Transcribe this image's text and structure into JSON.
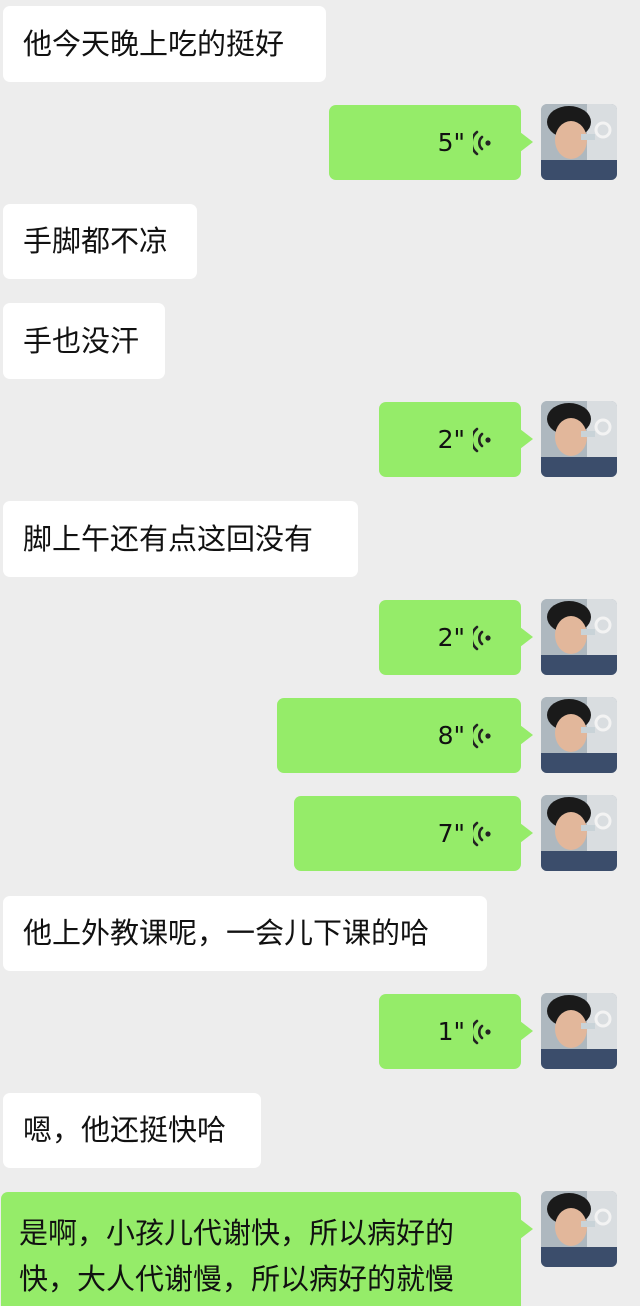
{
  "colors": {
    "background": "#ededed",
    "incoming_bubble": "#ffffff",
    "outgoing_bubble": "#95ec69",
    "text": "#111111"
  },
  "messages": [
    {
      "type": "text",
      "side": "in",
      "text": "他今天晚上吃的挺好"
    },
    {
      "type": "voice",
      "side": "out",
      "duration": "5\"",
      "icon": "voice-wave-icon"
    },
    {
      "type": "text",
      "side": "in",
      "text": "手脚都不凉"
    },
    {
      "type": "text",
      "side": "in",
      "text": "手也没汗"
    },
    {
      "type": "voice",
      "side": "out",
      "duration": "2\"",
      "icon": "voice-wave-icon"
    },
    {
      "type": "text",
      "side": "in",
      "text": "脚上午还有点这回没有"
    },
    {
      "type": "voice",
      "side": "out",
      "duration": "2\"",
      "icon": "voice-wave-icon"
    },
    {
      "type": "voice",
      "side": "out",
      "duration": "8\"",
      "icon": "voice-wave-icon"
    },
    {
      "type": "voice",
      "side": "out",
      "duration": "7\"",
      "icon": "voice-wave-icon"
    },
    {
      "type": "text",
      "side": "in",
      "text": "他上外教课呢，一会儿下课的哈"
    },
    {
      "type": "voice",
      "side": "out",
      "duration": "1\"",
      "icon": "voice-wave-icon"
    },
    {
      "type": "text",
      "side": "in",
      "text": "嗯，他还挺快哈"
    },
    {
      "type": "text",
      "side": "out",
      "text": "是啊，小孩儿代谢快，所以病好的快，大人代谢慢，所以病好的就慢"
    }
  ]
}
